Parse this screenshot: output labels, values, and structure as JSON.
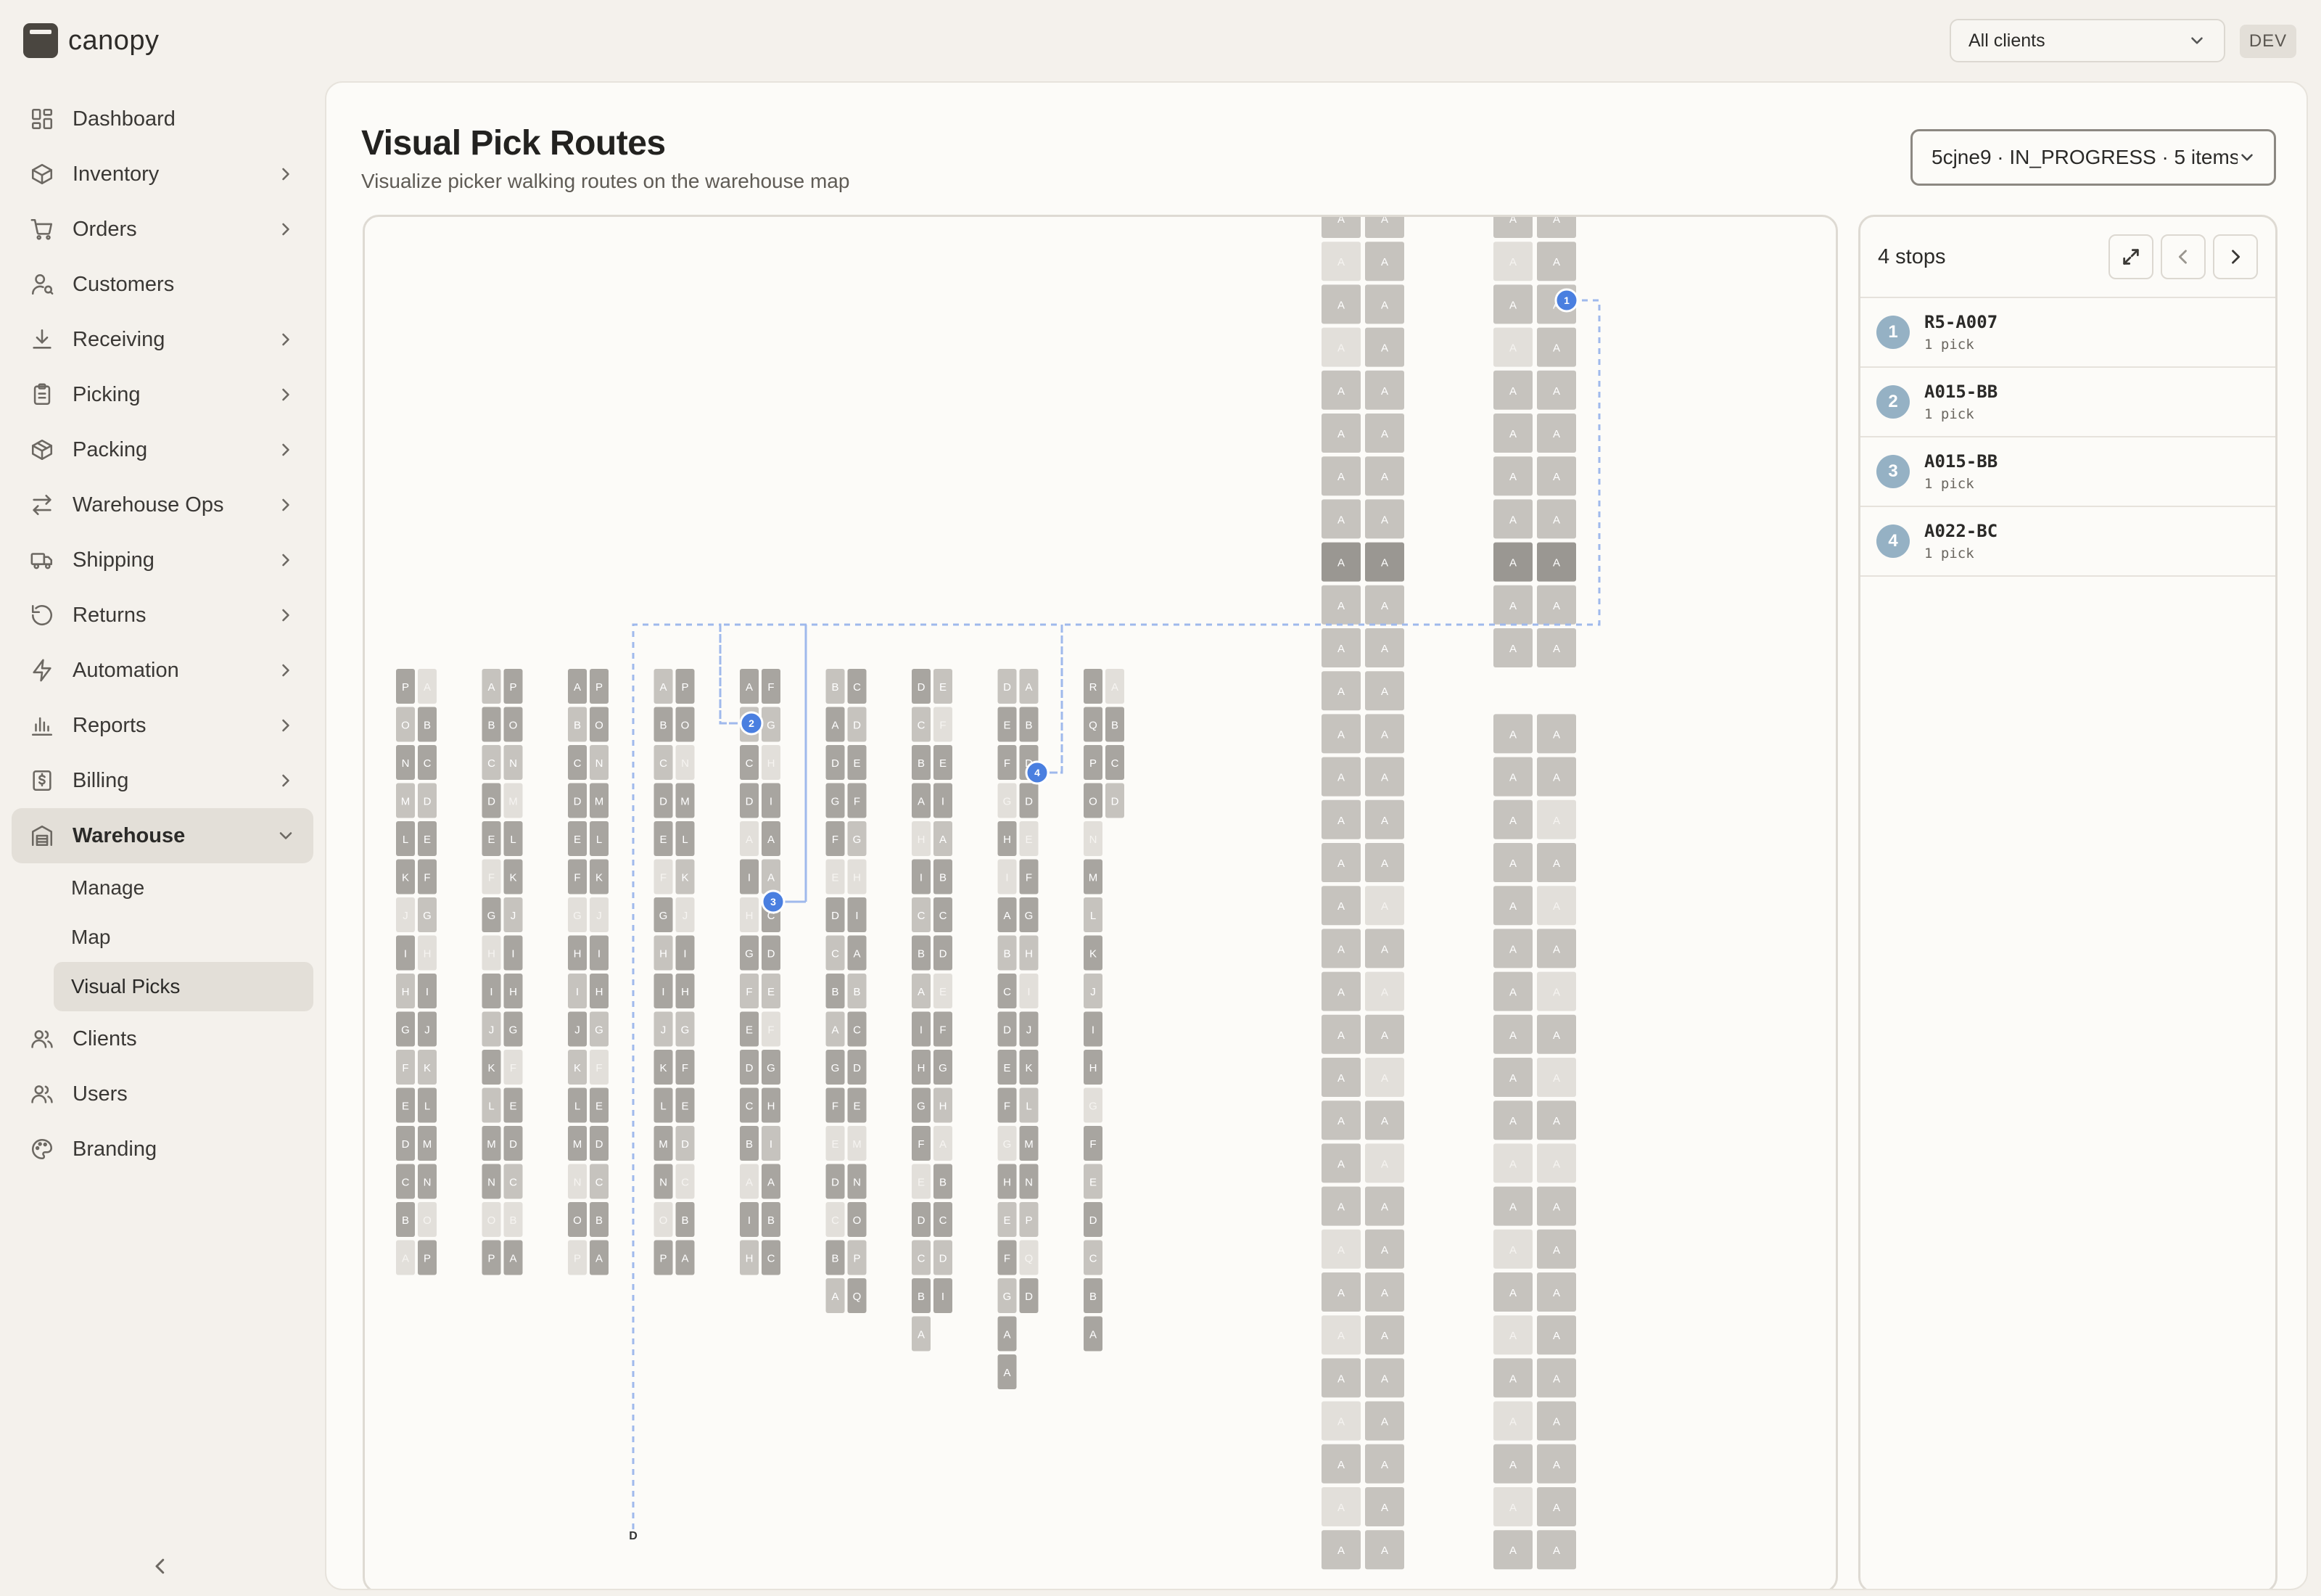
{
  "app": {
    "name": "canopy"
  },
  "sidebar": {
    "items": [
      {
        "key": "dashboard",
        "label": "Dashboard",
        "icon": "dashboard-icon",
        "chevron": false
      },
      {
        "key": "inventory",
        "label": "Inventory",
        "icon": "box-icon",
        "chevron": true
      },
      {
        "key": "orders",
        "label": "Orders",
        "icon": "cart-icon",
        "chevron": true
      },
      {
        "key": "customers",
        "label": "Customers",
        "icon": "user-search-icon",
        "chevron": false
      },
      {
        "key": "receiving",
        "label": "Receiving",
        "icon": "download-icon",
        "chevron": true
      },
      {
        "key": "picking",
        "label": "Picking",
        "icon": "clipboard-icon",
        "chevron": true
      },
      {
        "key": "packing",
        "label": "Packing",
        "icon": "package-icon",
        "chevron": true
      },
      {
        "key": "warehouse-ops",
        "label": "Warehouse Ops",
        "icon": "arrows-swap-icon",
        "chevron": true
      },
      {
        "key": "shipping",
        "label": "Shipping",
        "icon": "truck-icon",
        "chevron": true
      },
      {
        "key": "returns",
        "label": "Returns",
        "icon": "rotate-ccw-icon",
        "chevron": true
      },
      {
        "key": "automation",
        "label": "Automation",
        "icon": "bolt-icon",
        "chevron": true
      },
      {
        "key": "reports",
        "label": "Reports",
        "icon": "bar-chart-icon",
        "chevron": true
      },
      {
        "key": "billing",
        "label": "Billing",
        "icon": "receipt-icon",
        "chevron": true
      },
      {
        "key": "warehouse",
        "label": "Warehouse",
        "icon": "warehouse-icon",
        "chevron": true,
        "expanded": true,
        "active": true
      }
    ],
    "warehouse_sub": [
      {
        "key": "manage",
        "label": "Manage"
      },
      {
        "key": "map",
        "label": "Map"
      },
      {
        "key": "visual-picks",
        "label": "Visual Picks",
        "active": true
      }
    ],
    "bottom_items": [
      {
        "key": "clients",
        "label": "Clients",
        "icon": "users-icon"
      },
      {
        "key": "users",
        "label": "Users",
        "icon": "users-icon"
      },
      {
        "key": "branding",
        "label": "Branding",
        "icon": "palette-icon"
      }
    ]
  },
  "topbar": {
    "client_select": "All clients",
    "env_badge": "DEV"
  },
  "page": {
    "title": "Visual Pick Routes",
    "subtitle": "Visualize picker walking routes on the warehouse map",
    "route_select": "5cjne9 · IN_PROGRESS · 5 items"
  },
  "stops": {
    "count_label": "4 stops",
    "items": [
      {
        "num": "1",
        "location": "R5-A007",
        "picks": "1 pick"
      },
      {
        "num": "2",
        "location": "A015-BB",
        "picks": "1 pick"
      },
      {
        "num": "3",
        "location": "A015-BB",
        "picks": "1 pick"
      },
      {
        "num": "4",
        "location": "A022-BC",
        "picks": "1 pick"
      }
    ]
  },
  "map": {
    "start_label": "D",
    "racks": [
      {
        "left": "PONMLKJIHGFEDCBA",
        "right": "ABCDEFGHIJKLMNOP"
      },
      {
        "left": "ABCDEFGHIJKLMNOP",
        "right": "PONMLKJIHGFEDCBA"
      },
      {
        "left": "ABCDEFGHIJKLMNOP",
        "right": "PONMLKJIHGFEDCBA"
      },
      {
        "left": "ABCDEFGHIJKLMNOP",
        "right": "PONMLKJIHGFEDCBA"
      },
      {
        "left": "ABCDAIHGFEDCBAIH",
        "right": "FGHIAACDEFGHIABC"
      },
      {
        "left": "BADGFEDCBAGFEDCBA",
        "right": "CDEFGHIABCDEMNOPQ"
      },
      {
        "left": "DCBAHICBAIHGFEDCBA",
        "right": "EFEIABCDEFGHABCDI"
      },
      {
        "left": "DEFGHIABCDEFGHEFGAA",
        "right": "ABDDEFGHIJKLMNPQD"
      },
      {
        "left": "RQPONMLKJIHGFEDCBA",
        "right": "ABCD"
      }
    ],
    "tall_rack_count": 32,
    "tall_label": "A",
    "stops": [
      {
        "num": "1",
        "rack": "tall2",
        "row": 2
      },
      {
        "num": "2",
        "rack": 4,
        "row": 1
      },
      {
        "num": "3",
        "rack": 4,
        "row": 5
      },
      {
        "num": "4",
        "rack": 7,
        "row": 2
      }
    ],
    "colors": {
      "cell_dark": "#a8a5a0",
      "cell_mid": "#c6c3be",
      "cell_light": "#e2dfda",
      "cell_strong": "#9a9792",
      "route": "#9fb9ec",
      "stop": "#4a7fe0"
    }
  }
}
